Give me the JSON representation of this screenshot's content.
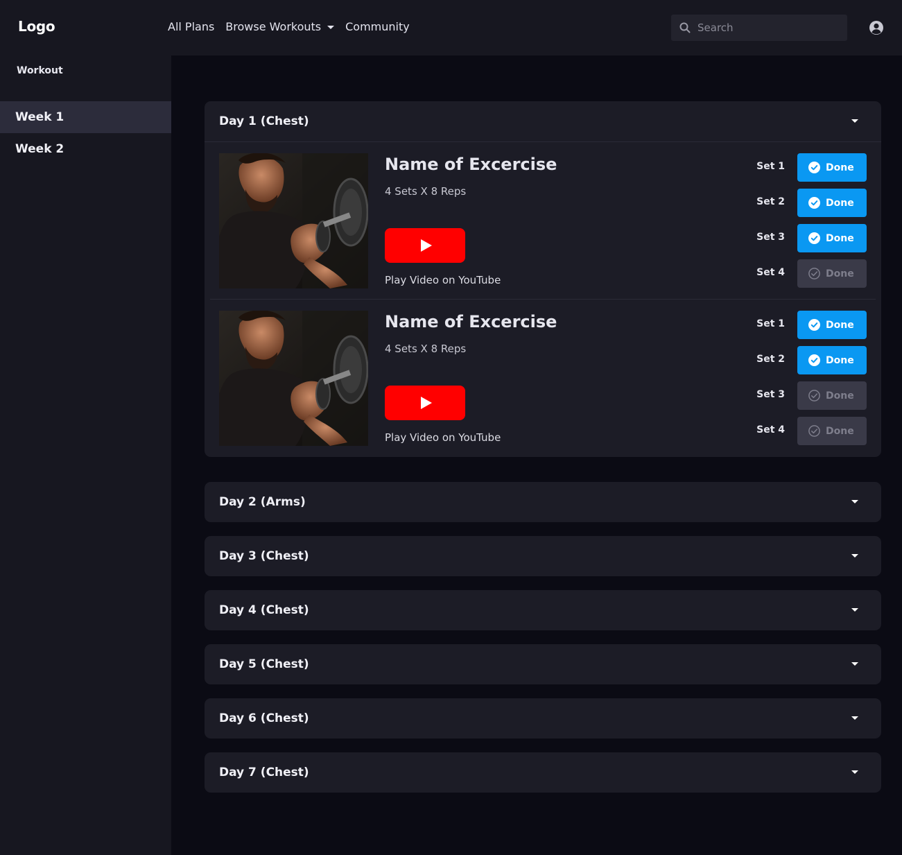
{
  "header": {
    "logo": "Logo",
    "nav": [
      {
        "label": "All Plans",
        "dropdown": false
      },
      {
        "label": "Browse Workouts",
        "dropdown": true
      },
      {
        "label": "Community",
        "dropdown": false
      }
    ],
    "search_placeholder": "Search"
  },
  "sidebar": {
    "title": "Workout",
    "weeks": [
      {
        "label": "Week 1",
        "active": true
      },
      {
        "label": "Week 2",
        "active": false
      }
    ]
  },
  "days": [
    {
      "label": "Day 1 (Chest)",
      "expanded": true
    },
    {
      "label": "Day 2 (Arms)",
      "expanded": false
    },
    {
      "label": "Day 3 (Chest)",
      "expanded": false
    },
    {
      "label": "Day 4 (Chest)",
      "expanded": false
    },
    {
      "label": "Day 5 (Chest)",
      "expanded": false
    },
    {
      "label": "Day 6 (Chest)",
      "expanded": false
    },
    {
      "label": "Day 7 (Chest)",
      "expanded": false
    }
  ],
  "exercises": [
    {
      "name": "Name of Excercise",
      "reps": "4 Sets X 8 Reps",
      "video_label": "Play Video on YouTube",
      "sets": [
        {
          "label": "Set 1",
          "done_label": "Done",
          "done": true
        },
        {
          "label": "Set 2",
          "done_label": "Done",
          "done": true
        },
        {
          "label": "Set 3",
          "done_label": "Done",
          "done": true
        },
        {
          "label": "Set 4",
          "done_label": "Done",
          "done": false
        }
      ]
    },
    {
      "name": "Name of Excercise",
      "reps": "4 Sets X 8 Reps",
      "video_label": "Play Video on YouTube",
      "sets": [
        {
          "label": "Set 1",
          "done_label": "Done",
          "done": true
        },
        {
          "label": "Set 2",
          "done_label": "Done",
          "done": true
        },
        {
          "label": "Set 3",
          "done_label": "Done",
          "done": false
        },
        {
          "label": "Set 4",
          "done_label": "Done",
          "done": false
        }
      ]
    }
  ],
  "colors": {
    "accent": "#0a98f2",
    "youtube": "#ff0000",
    "background": "#0b0b14",
    "panel": "#1c1c26"
  }
}
